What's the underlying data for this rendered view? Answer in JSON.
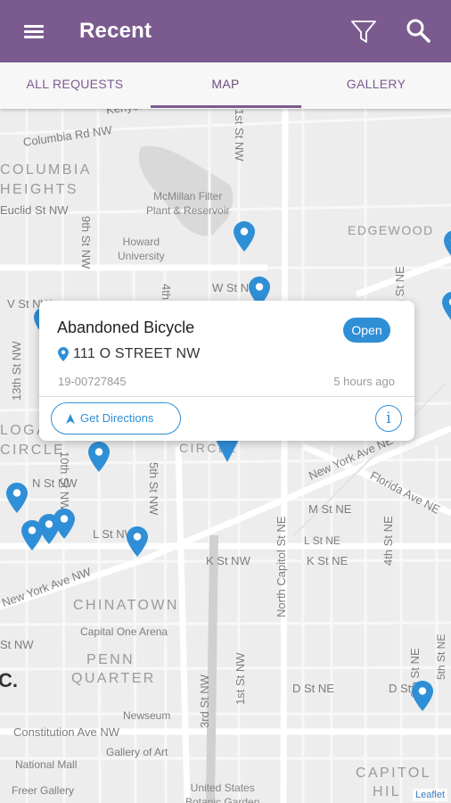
{
  "app": {
    "title": "Recent"
  },
  "header": {
    "menu_icon": "hamburger-menu-icon",
    "filter_icon": "filter-funnel-icon",
    "search_icon": "search-icon",
    "color": "#7b5b8f"
  },
  "tabs": [
    {
      "label": "ALL REQUESTS",
      "selected": false
    },
    {
      "label": "MAP",
      "selected": true
    },
    {
      "label": "GALLERY",
      "selected": false
    }
  ],
  "map": {
    "labels": {
      "kenyon": "Kenyon",
      "columbia_rd": "Columbia Rd NW",
      "columbia_heights_1": "COLUMBIA",
      "columbia_heights_2": "HEIGHTS",
      "euclid": "Euclid St NW",
      "ninth_top": "9th St NW",
      "first_st_top": "1st St NW",
      "mcmillan": "McMillan Filter\nPlant & Reservoir",
      "edgewood": "EDGEWOOD",
      "howard": "Howard\nUniversity",
      "fourth_st": "4th St NW",
      "w_st": "W St NW",
      "v_st": "V St NW",
      "thirteenth": "13th St NW",
      "logan_1": "LOGAN",
      "logan_2": "CIRCLE",
      "circle": "CIRCLE",
      "tenth": "10th St NW",
      "n_st": "N St NW",
      "fifth": "5th St NW",
      "new_york_ne": "New York Ave NE",
      "florida_ne": "Florida Ave NE",
      "m_st_ne": "M St NE",
      "l_st_ne": "L St NE",
      "k_st_ne": "K St NE",
      "fourth_ne": "4th St NE",
      "n_capitol": "North Capitol St NE",
      "k_st_nw": "K St NW",
      "l_st_nw": "L St NW",
      "new_york_nw": "New York Ave NW",
      "chinatown": "CHINATOWN",
      "capital_one": "Capital One Arena",
      "penn_1": "PENN",
      "penn_2": "QUARTER",
      "third_nw": "3rd St NW",
      "first_nw": "1st St NW",
      "d_st_ne": "D St NE",
      "d_st_ne2": "D St",
      "sixth_ne": "6th St NE",
      "fifth_ne": "5th St NE",
      "st_nw_left": "St NW",
      "newseum": "Newseum",
      "constitution": "Constitution Ave NW",
      "gallery_art": "Gallery of Art",
      "national_mall": "National Mall",
      "freer": "Freer Gallery",
      "botanic": "United States\nBotanic Garden",
      "capitol_hill_1": "CAPITOL",
      "capitol_hill_2": "HIL",
      "dc_letter": "C."
    },
    "attribution": "Leaflet",
    "pin_color": "#2f8fd6",
    "pin_icon": "map-marker-icon"
  },
  "popup": {
    "title": "Abandoned Bicycle",
    "status": "Open",
    "address": "111 O STREET NW",
    "request_id": "19-00727845",
    "time_ago": "5 hours ago",
    "directions_label": "Get Directions",
    "info_label": "i"
  }
}
